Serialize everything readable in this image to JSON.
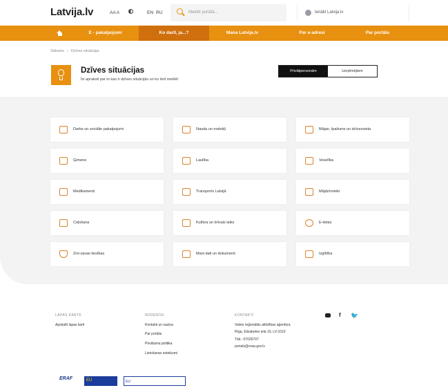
{
  "header": {
    "logo_main": "Latvija.lv",
    "font_size_label": "AA A",
    "lang_en": "EN",
    "lang_ru": "RU",
    "search_placeholder": "Meklēt portālā...",
    "login_label": "Ienākt Latvija.lv"
  },
  "nav": {
    "items": [
      {
        "label": "E - pakalpojumi"
      },
      {
        "label": "Ko darīt, ja...?"
      },
      {
        "label": "Mana Latvija.lv"
      },
      {
        "label": "Par e-adresi"
      },
      {
        "label": "Par portālu"
      }
    ]
  },
  "breadcrumb": {
    "home": "Sākums",
    "current": "Dzīves situācijas"
  },
  "hero": {
    "title": "Dzīves situācijas",
    "subtitle": "Īsi apraksti par to kas ir dzīves situācijās un ko šeit meklēt"
  },
  "toggle": {
    "option_1": "Privātpersonām",
    "option_2": "Uzņēmējiem"
  },
  "cards": [
    {
      "label": "Darbs un sociālie pakalpojumi",
      "icon": "briefcase-icon"
    },
    {
      "label": "Nauda un nodokļi",
      "icon": "coins-icon"
    },
    {
      "label": "Mājas, īpašums un dzīvesvieta",
      "icon": "house-icon"
    },
    {
      "label": "Ģimene",
      "icon": "family-icon"
    },
    {
      "label": "Laulība",
      "icon": "rings-icon"
    },
    {
      "label": "Veselība",
      "icon": "medical-kit-icon"
    },
    {
      "label": "Medikamenti",
      "icon": "pills-icon"
    },
    {
      "label": "Transports Latvijā",
      "icon": "car-icon"
    },
    {
      "label": "Mājdzīvnieki",
      "icon": "paw-icon"
    },
    {
      "label": "Ceļošana",
      "icon": "plane-icon"
    },
    {
      "label": "Kultūra un brīvais laiks",
      "icon": "masks-icon"
    },
    {
      "label": "E-lietas",
      "icon": "at-icon"
    },
    {
      "label": "Zini savas tiesības",
      "icon": "shield-icon"
    },
    {
      "label": "Mani dati un dokumenti",
      "icon": "document-icon"
    },
    {
      "label": "Izglītība",
      "icon": "graduation-cap-icon"
    }
  ],
  "footer": {
    "col1_title": "LAPAS KARTE",
    "col1_links": [
      "Apskatīt lapas karti"
    ],
    "col2_title": "NODERĪGI",
    "col2_links": [
      "Kontakti un saziņa",
      "Par portālu",
      "Privātuma politika",
      "Lietošanas noteikumi"
    ],
    "col3_title": "KONTAKTI",
    "col3_lines": [
      "Valsts reģionālās attīstības aģentūra",
      "Rīga, Elizabetes iela 19, LV-1010",
      "Tālr.: 67026797",
      "portals@vraa.gov.lv"
    ],
    "social": {
      "facebook": "f"
    },
    "logos": [
      "ERAF",
      "EU",
      "EU"
    ]
  },
  "colors": {
    "accent": "#e8900f",
    "accent_dark": "#cf6f0d",
    "grey_bg": "#f3f3f3"
  }
}
